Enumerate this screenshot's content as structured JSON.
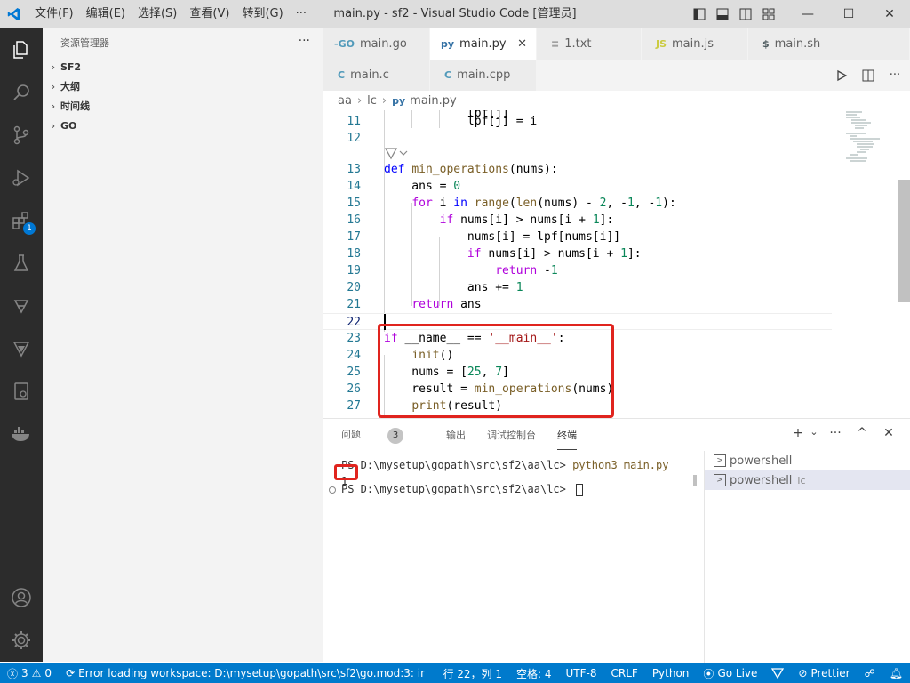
{
  "window": {
    "title": "main.py - sf2 - Visual Studio Code [管理员]",
    "menu": [
      "文件(F)",
      "编辑(E)",
      "选择(S)",
      "查看(V)",
      "转到(G)",
      "···"
    ],
    "controls": {
      "minimize": "—",
      "maximize": "☐",
      "close": "✕"
    }
  },
  "activity_bar": {
    "extensions_badge": "1"
  },
  "sidebar": {
    "title": "资源管理器",
    "more": "···",
    "sections": [
      "SF2",
      "大纲",
      "时间线",
      "GO"
    ]
  },
  "tabs": [
    {
      "icon": "-GO",
      "label": "main.go"
    },
    {
      "icon": "py",
      "label": "main.py",
      "close": "✕"
    },
    {
      "icon": "≡",
      "label": "1.txt"
    },
    {
      "icon": "JS",
      "label": "main.js"
    },
    {
      "icon": "$",
      "label": "main.sh"
    },
    {
      "icon": "C",
      "label": "main.c"
    },
    {
      "icon": "C",
      "label": "main.cpp"
    }
  ],
  "breadcrumb": [
    "aa",
    "lc",
    "main.py"
  ],
  "editor": {
    "lines": [
      {
        "num": "",
        "text": "            lpf[j]"
      },
      {
        "num": "11",
        "text": "            lpf[j] = i"
      },
      {
        "num": "12",
        "text": ""
      },
      {
        "num": "13",
        "text": "def min_operations(nums):"
      },
      {
        "num": "14",
        "text": "    ans = 0"
      },
      {
        "num": "15",
        "text": "    for i in range(len(nums) - 2, -1, -1):"
      },
      {
        "num": "16",
        "text": "        if nums[i] > nums[i + 1]:"
      },
      {
        "num": "17",
        "text": "            nums[i] = lpf[nums[i]]"
      },
      {
        "num": "18",
        "text": "            if nums[i] > nums[i + 1]:"
      },
      {
        "num": "19",
        "text": "                return -1"
      },
      {
        "num": "20",
        "text": "            ans += 1"
      },
      {
        "num": "21",
        "text": "    return ans"
      },
      {
        "num": "22",
        "text": ""
      },
      {
        "num": "23",
        "text": "if __name__ == '__main__':"
      },
      {
        "num": "24",
        "text": "    init()"
      },
      {
        "num": "25",
        "text": "    nums = [25, 7]"
      },
      {
        "num": "26",
        "text": "    result = min_operations(nums)"
      },
      {
        "num": "27",
        "text": "    print(result)"
      }
    ]
  },
  "panel": {
    "tabs": [
      "问题",
      "输出",
      "调试控制台",
      "终端"
    ],
    "problems_count": "3",
    "actions": [
      "+",
      "⌄",
      "···",
      "^",
      "✕"
    ],
    "terminal": {
      "prompt1": "PS D:\\mysetup\\gopath\\src\\sf2\\aa\\lc> ",
      "command": "python3 main.py",
      "output": "1",
      "prompt2": "PS D:\\mysetup\\gopath\\src\\sf2\\aa\\lc> "
    },
    "terminal_list": [
      {
        "label": "powershell",
        "sub": ""
      },
      {
        "label": "powershell",
        "sub": "lc"
      }
    ]
  },
  "status_bar": {
    "errors": "3",
    "warnings": "0",
    "message": "Error loading workspace: D:\\mysetup\\gopath\\src\\sf2\\go.mod:3: invalid g",
    "position": "行 22，列 1",
    "spaces": "空格: 4",
    "encoding": "UTF-8",
    "eol": "CRLF",
    "language": "Python",
    "go_live": "Go Live",
    "prettier": "Prettier"
  },
  "colors": {
    "accent": "#007acc",
    "activity_bar": "#2c2c2c",
    "highlight_box": "#e0241e"
  }
}
